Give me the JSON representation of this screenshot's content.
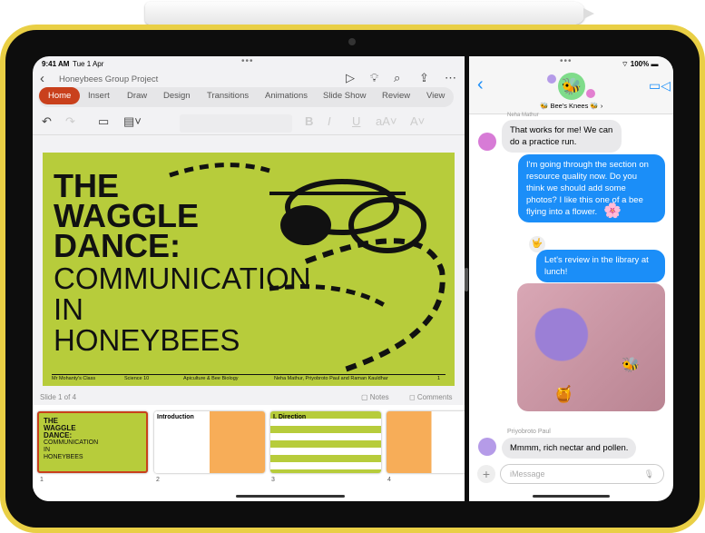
{
  "status_left": {
    "time": "9:41 AM",
    "date": "Tue 1 Apr"
  },
  "status_right": {
    "battery": "100%"
  },
  "ppt": {
    "doc_title": "Honeybees Group Project",
    "tabs": [
      "Home",
      "Insert",
      "Draw",
      "Design",
      "Transitions",
      "Animations",
      "Slide Show",
      "Review",
      "View"
    ],
    "active_tab": "Home",
    "accent": "#c9401c",
    "slide": {
      "title_bold": [
        "THE",
        "WAGGLE",
        "DANCE:"
      ],
      "title_light": [
        "COMMUNICATION",
        "IN",
        "HONEYBEES"
      ],
      "footer": [
        "Mr Mohanty's Class",
        "Science 10",
        "Apiculture & Bee Biology",
        "Neha Mathur, Priyobroto Paul and Raman Kauldhar",
        "1"
      ],
      "bg": "#b7cc3b"
    },
    "slide_counter": "Slide 1 of 4",
    "notes_label": "Notes",
    "comments_label": "Comments",
    "thumbnails": [
      {
        "num": "1",
        "label": "THE WAGGLE DANCE: COMMUNICATION IN HONEYBEES"
      },
      {
        "num": "2",
        "label": "Introduction"
      },
      {
        "num": "3",
        "label": "I. Direction"
      },
      {
        "num": "4",
        "label": ""
      }
    ]
  },
  "messages": {
    "group_name": "Bee's Knees",
    "sender_top": "Neha Mathur",
    "items": [
      {
        "from": "Neha Mathur",
        "dir": "in",
        "text": "That works for me! We can do a practice run."
      },
      {
        "dir": "out",
        "text": "I'm going through the section on resource quality now. Do you think we should add some photos? I like this one of a bee flying into a flower."
      },
      {
        "dir": "out",
        "text": "Let's review in the library at lunch!"
      },
      {
        "from": "Priyobroto Paul",
        "dir": "in",
        "text": "Mmmm, rich nectar and pollen."
      }
    ],
    "input_placeholder": "iMessage",
    "bubble_color": "#1b8ef8"
  }
}
